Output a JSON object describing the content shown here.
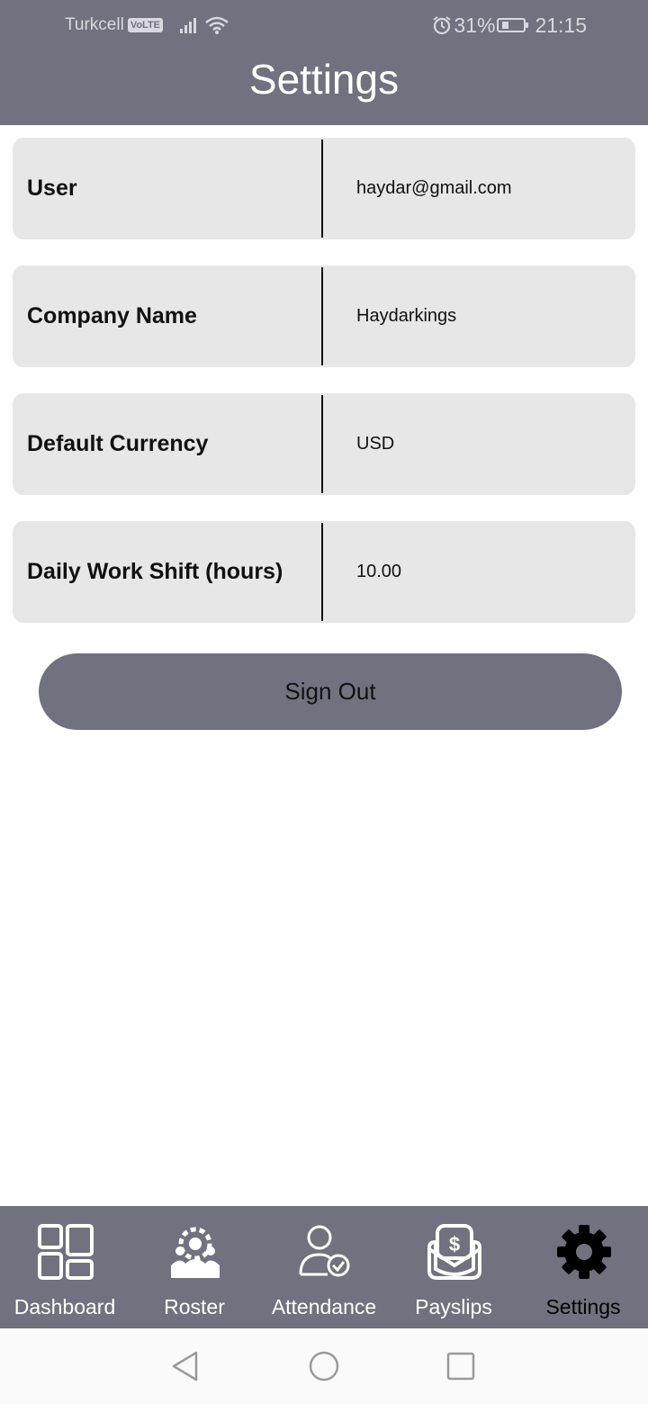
{
  "status_bar": {
    "carrier": "Turkcell",
    "volte_badge": "VoLTE",
    "battery_percent": "31%",
    "battery_level": 0.31,
    "time": "21:15"
  },
  "header": {
    "title": "Settings"
  },
  "settings": [
    {
      "label": "User",
      "value": "haydar@gmail.com"
    },
    {
      "label": "Company Name",
      "value": "Haydarkings"
    },
    {
      "label": "Default Currency",
      "value": "USD"
    },
    {
      "label": "Daily Work Shift (hours)",
      "value": "10.00"
    }
  ],
  "sign_out_label": "Sign Out",
  "bottom_nav": [
    {
      "label": "Dashboard",
      "icon": "dashboard-icon",
      "active": false
    },
    {
      "label": "Roster",
      "icon": "roster-icon",
      "active": false
    },
    {
      "label": "Attendance",
      "icon": "attendance-icon",
      "active": false
    },
    {
      "label": "Payslips",
      "icon": "payslips-icon",
      "active": false
    },
    {
      "label": "Settings",
      "icon": "gear-icon",
      "active": true
    }
  ],
  "system_nav": {
    "back": "back-icon",
    "home": "home-icon",
    "recents": "recents-icon"
  },
  "colors": {
    "header_bg": "#72717f",
    "row_bg": "#e7e7e7",
    "button_bg": "#72717f"
  }
}
